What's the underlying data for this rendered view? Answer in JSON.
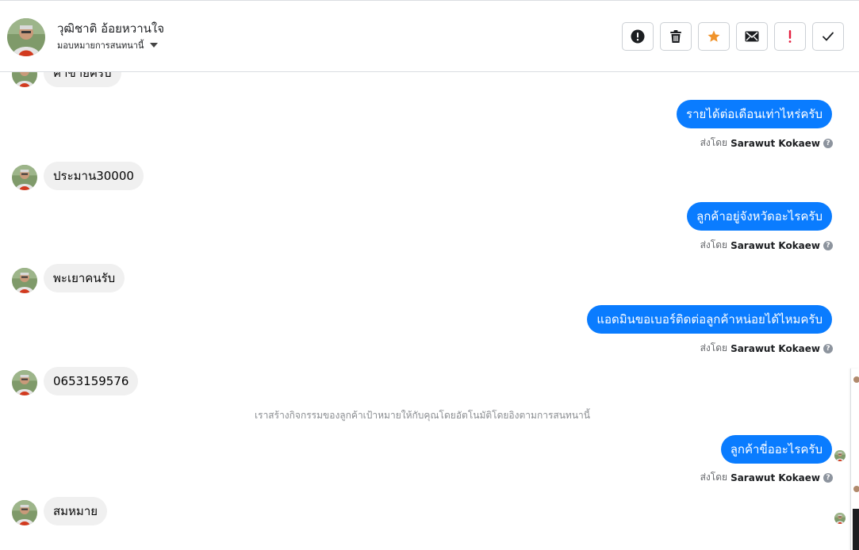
{
  "header": {
    "contact_name": "วุฒิชาติ อ้อยหวานใจ",
    "assign_label": "มอบหมายการสนทนานี้",
    "avatar_icon": "contact-avatar"
  },
  "actions": [
    {
      "name": "report-button",
      "icon": "alert-circle-icon"
    },
    {
      "name": "delete-button",
      "icon": "trash-icon"
    },
    {
      "name": "star-button",
      "icon": "star-icon",
      "color": "#f0932b"
    },
    {
      "name": "mark-unread-button",
      "icon": "envelope-icon"
    },
    {
      "name": "follow-up-button",
      "icon": "exclamation-icon",
      "color": "#e41e3f"
    },
    {
      "name": "mark-done-button",
      "icon": "check-icon"
    }
  ],
  "messages": [
    {
      "id": "m0",
      "direction": "in",
      "text": "ค่าขายครับ"
    },
    {
      "id": "m1",
      "direction": "out",
      "text": "รายได้ต่อเดือนเท่าไหร่ครับ",
      "sent_by_prefix": "ส่งโดย",
      "sent_by_name": "Sarawut Kokaew"
    },
    {
      "id": "m2",
      "direction": "in",
      "text": "ประมาน30000"
    },
    {
      "id": "m3",
      "direction": "out",
      "text": "ลูกค้าอยู่จังหวัดอะไรครับ",
      "sent_by_prefix": "ส่งโดย",
      "sent_by_name": "Sarawut Kokaew"
    },
    {
      "id": "m4",
      "direction": "in",
      "text": "พะเยาคนรับ"
    },
    {
      "id": "m5",
      "direction": "out",
      "text": "แอดมินขอเบอร์ติดต่อลูกค้าหน่อยได้ไหมครับ",
      "sent_by_prefix": "ส่งโดย",
      "sent_by_name": "Sarawut Kokaew"
    },
    {
      "id": "m6",
      "direction": "in",
      "text": "0653159576"
    },
    {
      "id": "m7",
      "direction": "system",
      "text": "เราสร้างกิจกรรมของลูกค้าเป้าหมายให้กับคุณโดยอัตโนมัติโดยอิงตามการสนทนานี้"
    },
    {
      "id": "m8",
      "direction": "out",
      "text": "ลูกค้าขี่ออะไรครับ",
      "sent_by_prefix": "ส่งโดย",
      "sent_by_name": "Sarawut Kokaew"
    },
    {
      "id": "m9",
      "direction": "in",
      "text": "สมหมาย"
    }
  ],
  "colors": {
    "outgoing_bubble": "#0a7cff",
    "incoming_bubble": "#f0f0f0",
    "meta_text": "#65676b"
  }
}
